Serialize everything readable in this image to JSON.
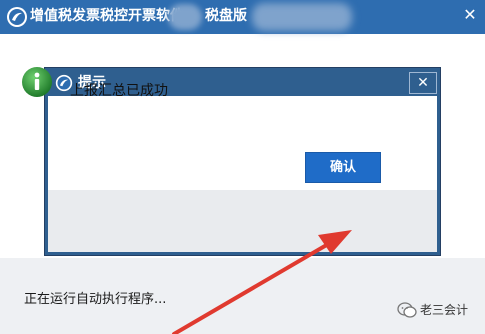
{
  "window": {
    "title_part1": "增值税发票税控开票软件",
    "title_part2": "税盘版",
    "close_glyph": "✕"
  },
  "dialog": {
    "title": "提示",
    "close_glyph": "✕",
    "message": "上报汇总已成功",
    "confirm_label": "确认",
    "icon": "info-icon"
  },
  "status": {
    "running_text": "正在运行自动执行程序..."
  },
  "watermark": {
    "text": "老三会计"
  },
  "colors": {
    "titlebar": "#2e6db0",
    "dialog_frame": "#2f5f8f",
    "confirm_button": "#1f6cc8",
    "info_icon": "#2d9a3a",
    "arrow": "#e03a2f"
  }
}
